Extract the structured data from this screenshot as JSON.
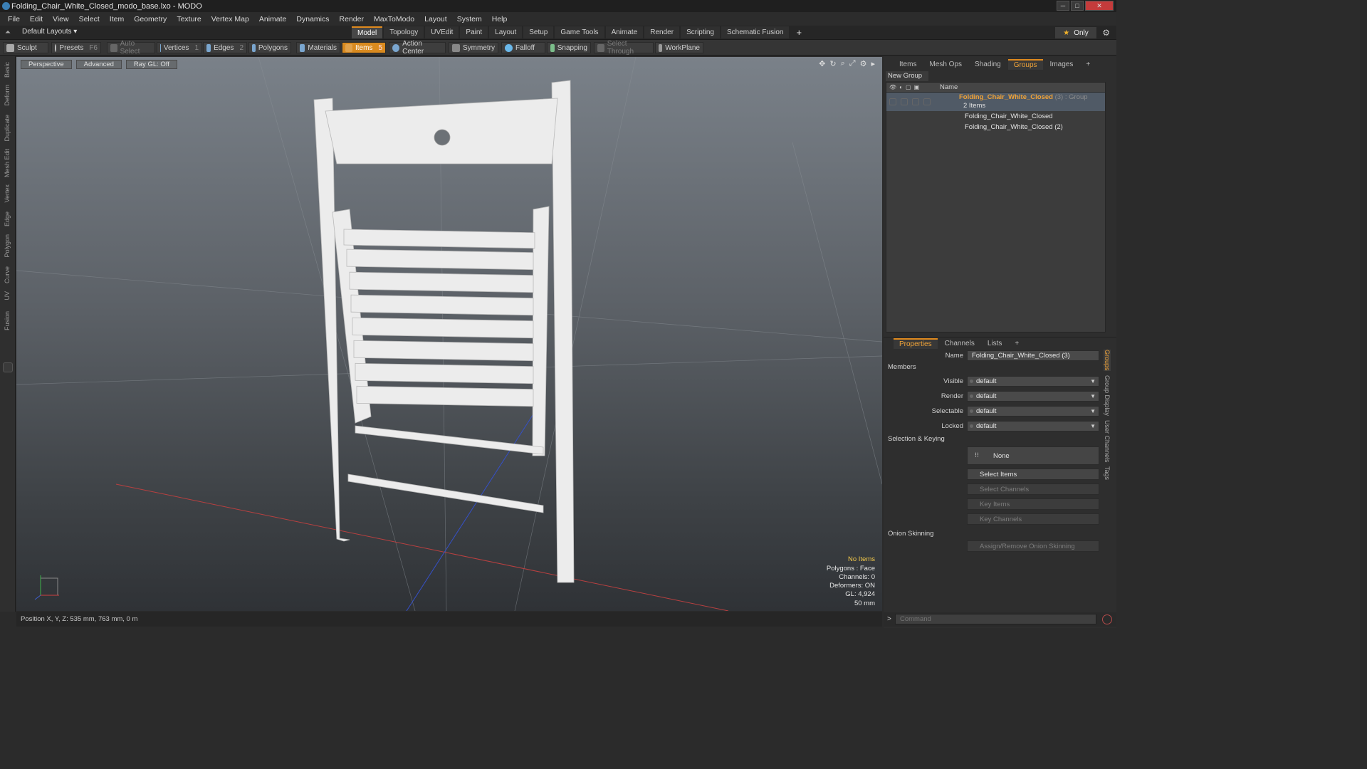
{
  "window": {
    "title": "Folding_Chair_White_Closed_modo_base.lxo - MODO"
  },
  "menu": [
    "File",
    "Edit",
    "View",
    "Select",
    "Item",
    "Geometry",
    "Texture",
    "Vertex Map",
    "Animate",
    "Dynamics",
    "Render",
    "MaxToModo",
    "Layout",
    "System",
    "Help"
  ],
  "layouts": {
    "current": "Default Layouts ▾",
    "tabs": [
      "Model",
      "Topology",
      "UVEdit",
      "Paint",
      "Layout",
      "Setup",
      "Game Tools",
      "Animate",
      "Render",
      "Scripting",
      "Schematic Fusion"
    ],
    "active": "Model",
    "only": "Only"
  },
  "toolbar": {
    "sculpt": "Sculpt",
    "presets": "Presets",
    "presets_key": "F6",
    "auto_select": "Auto Select",
    "vertices": "Vertices",
    "vertices_count": "1",
    "edges": "Edges",
    "edges_count": "2",
    "polygons": "Polygons",
    "materials": "Materials",
    "items": "Items",
    "items_count": "5",
    "action_center": "Action Center",
    "symmetry": "Symmetry",
    "falloff": "Falloff",
    "snapping": "Snapping",
    "select_through": "Select Through",
    "workplane": "WorkPlane"
  },
  "left_tabs": [
    "Basic",
    "Deform",
    "Duplicate",
    "Mesh Edit",
    "Vertex",
    "Edge",
    "Polygon",
    "Curve",
    "UV",
    "Fusion"
  ],
  "viewport": {
    "view": "Perspective",
    "mode": "Advanced",
    "raygl": "Ray GL: Off",
    "info": {
      "no_items": "No Items",
      "polygons": "Polygons : Face",
      "channels": "Channels: 0",
      "deformers": "Deformers: ON",
      "gl": "GL: 4,924",
      "scale": "50 mm"
    }
  },
  "status": {
    "position": "Position X, Y, Z:   535 mm, 763 mm, 0 m"
  },
  "right_tabs": [
    "Items",
    "Mesh Ops",
    "Shading",
    "Groups",
    "Images"
  ],
  "right_active": "Groups",
  "groups": {
    "new_group": "New Group",
    "name_header": "Name",
    "group_name": "Folding_Chair_White_Closed",
    "group_suffix": "(3) : Group",
    "group_count": "2 Items",
    "children": [
      "Folding_Chair_White_Closed",
      "Folding_Chair_White_Closed (2)"
    ]
  },
  "prop_tabs": [
    "Properties",
    "Channels",
    "Lists"
  ],
  "properties": {
    "name_label": "Name",
    "name_value": "Folding_Chair_White_Closed (3)",
    "members": "Members",
    "visible_label": "Visible",
    "visible": "default",
    "render_label": "Render",
    "render": "default",
    "selectable_label": "Selectable",
    "selectable": "default",
    "locked_label": "Locked",
    "locked": "default",
    "selection_keying": "Selection & Keying",
    "none": "None",
    "select_items": "Select Items",
    "select_channels": "Select Channels",
    "key_items": "Key Items",
    "key_channels": "Key Channels",
    "onion": "Onion Skinning",
    "assign_onion": "Assign/Remove Onion Skinning"
  },
  "side_tabs": [
    "Groups",
    "Group Display",
    "User Channels",
    "Tags"
  ],
  "command": {
    "placeholder": "Command"
  }
}
